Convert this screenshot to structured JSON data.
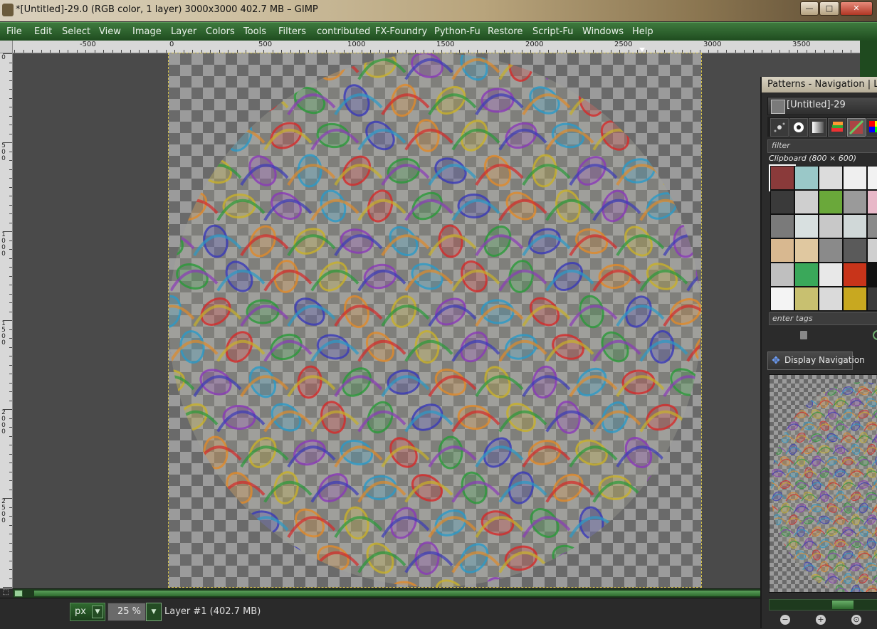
{
  "window": {
    "title": "*[Untitled]-29.0 (RGB color, 1 layer) 3000x3000 402.7 MB – GIMP",
    "minimize": "—",
    "maximize": "□",
    "close": "✕"
  },
  "menu": [
    "File",
    "Edit",
    "Select",
    "View",
    "Image",
    "Layer",
    "Colors",
    "Tools",
    "Filters",
    "contributed",
    "FX-Foundry",
    "Python-Fu",
    "Restore",
    "Script-Fu",
    "Windows",
    "Help"
  ],
  "ruler": {
    "h_labels": [
      "-500",
      "0",
      "500",
      "1000",
      "1500",
      "2000",
      "2500",
      "3000",
      "3500"
    ],
    "v_labels": [
      "0",
      "500",
      "1000",
      "1500",
      "2000",
      "2500"
    ]
  },
  "status": {
    "unit": "px",
    "zoom": "25 %",
    "layer_info": "Layer #1 (402.7 MB)"
  },
  "dock": {
    "title": "Patterns - Navigation | Layers",
    "image_name": "[Untitled]-29",
    "filter_placeholder": "filter",
    "pattern_label": "Clipboard (800 × 600)",
    "tags_placeholder": "enter tags",
    "nav_tab_label": "Display Navigation"
  },
  "colors": {
    "menubar": "#2e6a2e",
    "accent": "#3e7a3e"
  }
}
